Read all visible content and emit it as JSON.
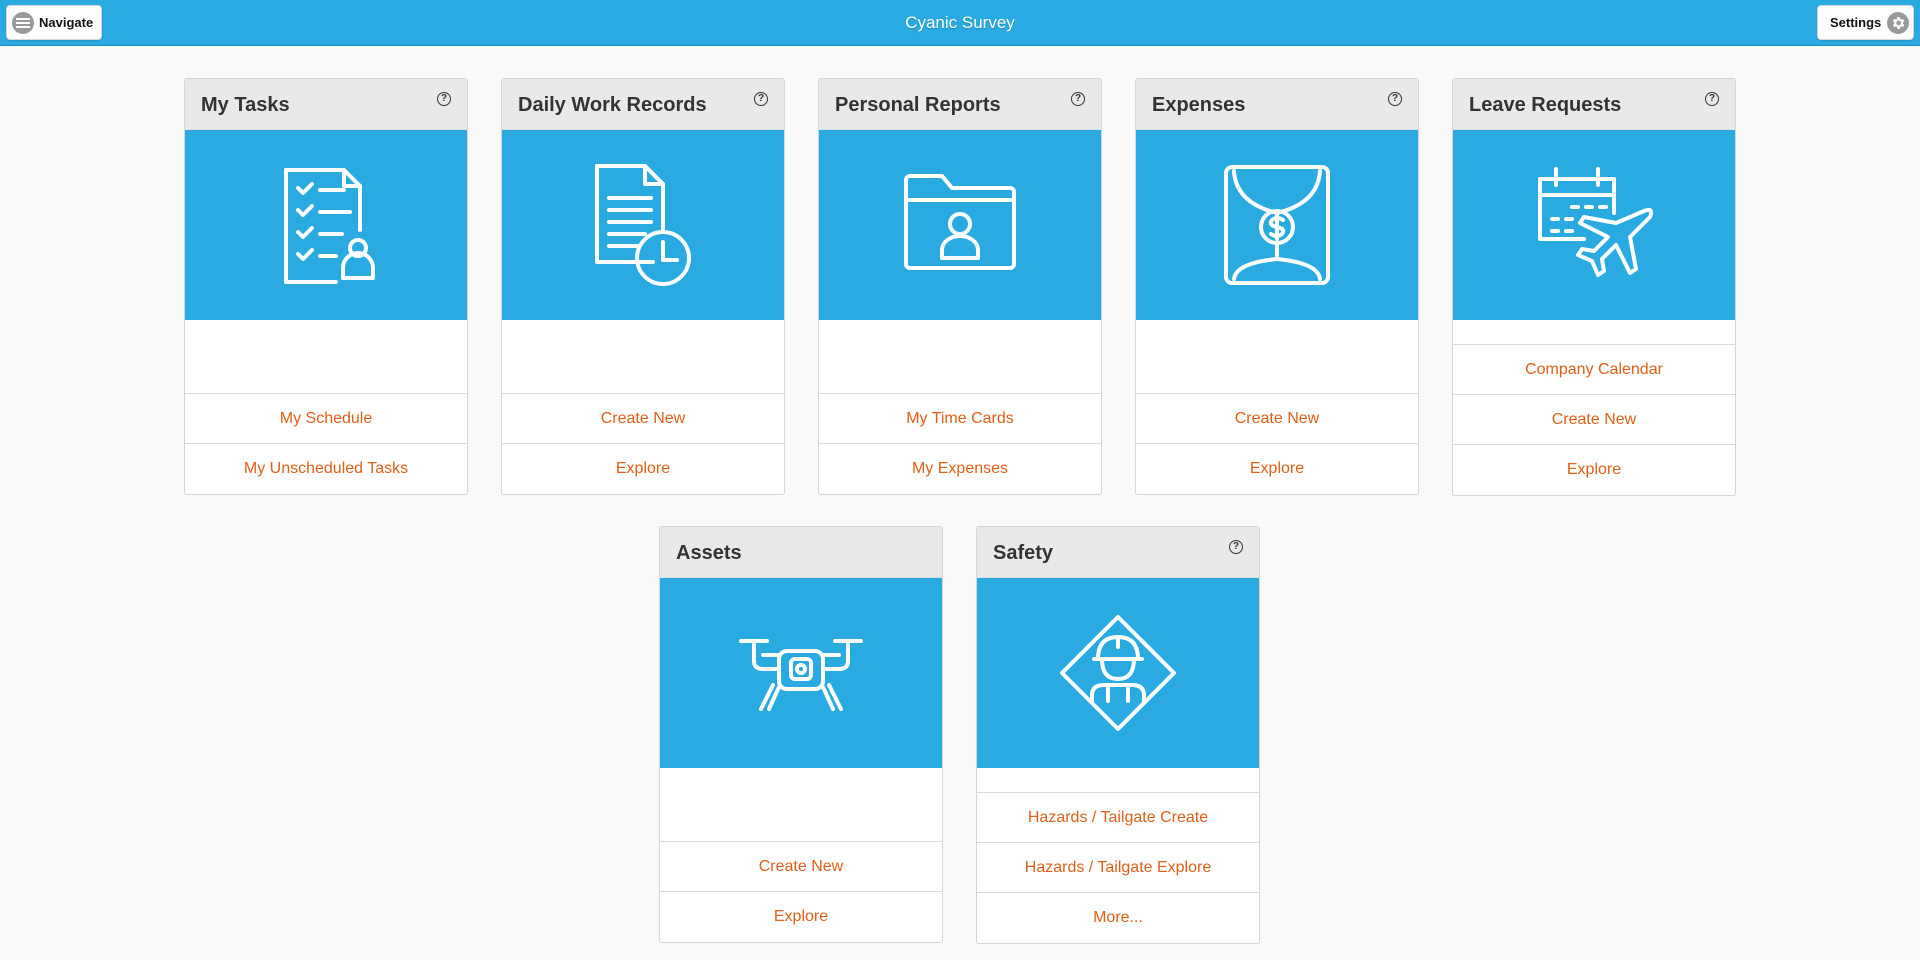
{
  "header": {
    "title": "Cyanic Survey",
    "navigate_label": "Navigate",
    "settings_label": "Settings",
    "accent_color": "#29abe2"
  },
  "link_color": "#e0601b",
  "tiles": [
    {
      "title": "My Tasks",
      "icon": "task-checklist-user-icon",
      "help": true,
      "links": [
        "My Schedule",
        "My Unscheduled Tasks"
      ]
    },
    {
      "title": "Daily Work Records",
      "icon": "document-clock-icon",
      "help": true,
      "links": [
        "Create New",
        "Explore"
      ]
    },
    {
      "title": "Personal Reports",
      "icon": "user-folder-icon",
      "help": true,
      "links": [
        "My Time Cards",
        "My Expenses"
      ]
    },
    {
      "title": "Expenses",
      "icon": "dollar-envelope-icon",
      "help": true,
      "links": [
        "Create New",
        "Explore"
      ]
    },
    {
      "title": "Leave Requests",
      "icon": "calendar-airplane-icon",
      "help": true,
      "links": [
        "Company Calendar",
        "Create New",
        "Explore"
      ]
    },
    {
      "title": "Assets",
      "icon": "drone-icon",
      "help": false,
      "links": [
        "Create New",
        "Explore"
      ]
    },
    {
      "title": "Safety",
      "icon": "construction-worker-sign-icon",
      "help": true,
      "links": [
        "Hazards / Tailgate Create",
        "Hazards / Tailgate Explore",
        "More..."
      ]
    }
  ]
}
